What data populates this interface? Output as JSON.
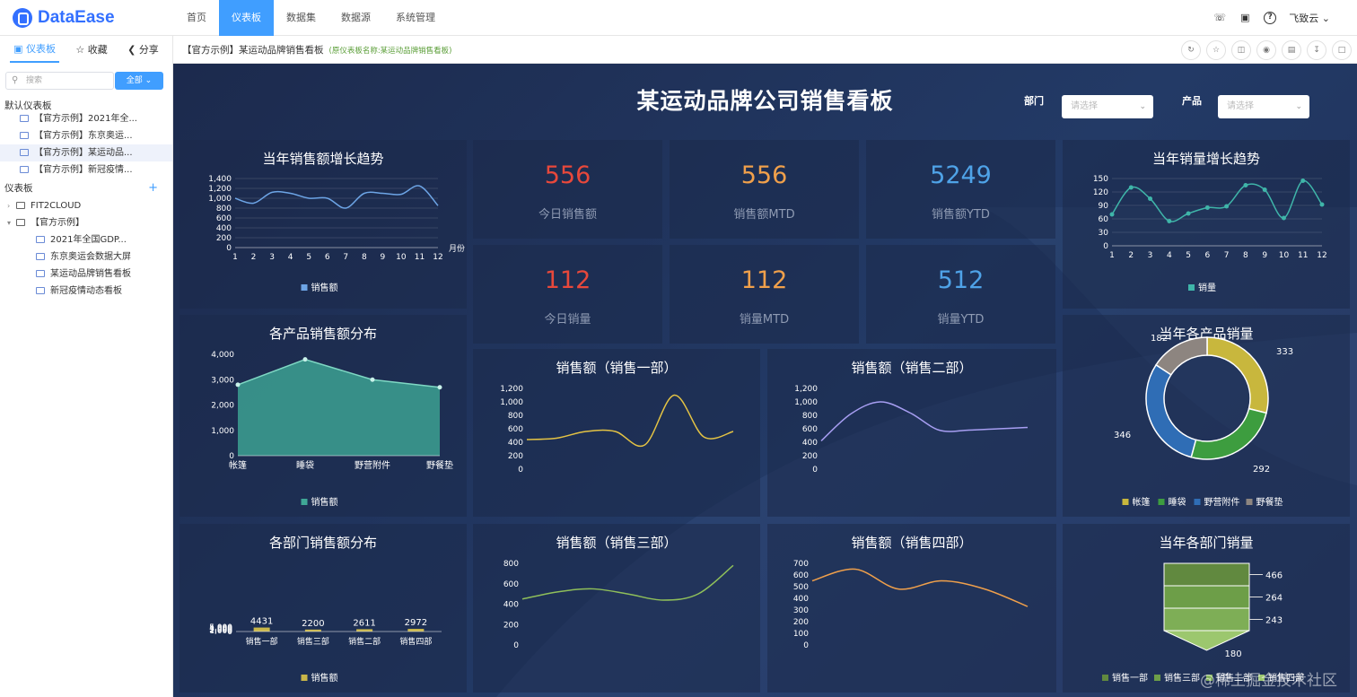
{
  "app": {
    "logo": "DataEase",
    "user": "飞致云"
  },
  "nav": [
    "首页",
    "仪表板",
    "数据集",
    "数据源",
    "系统管理"
  ],
  "sidebar": {
    "tabs": [
      "仪表板",
      "收藏",
      "分享"
    ],
    "search_placeholder": "搜索",
    "filter_label": "全部",
    "default_section": "默认仪表板",
    "default_items": [
      "【官方示例】2021年全...",
      "【官方示例】东京奥运...",
      "【官方示例】某运动品...",
      "【官方示例】新冠疫情..."
    ],
    "board_section": "仪表板",
    "tree": [
      {
        "label": "FIT2CLOUD",
        "level": 0,
        "type": "folder"
      },
      {
        "label": "【官方示例】",
        "level": 0,
        "type": "folder"
      },
      {
        "label": "2021年全国GDP...",
        "level": 1,
        "type": "dashboard"
      },
      {
        "label": "东京奥运会数据大屏",
        "level": 1,
        "type": "dashboard"
      },
      {
        "label": "某运动品牌销售看板",
        "level": 1,
        "type": "dashboard"
      },
      {
        "label": "新冠疫情动态看板",
        "level": 1,
        "type": "dashboard"
      }
    ]
  },
  "breadcrumb": {
    "title": "【官方示例】某运动品牌销售看板",
    "subtitle": "(原仪表板名称:某运动品牌销售看板)"
  },
  "board": {
    "title": "某运动品牌公司销售看板",
    "filters": [
      {
        "label": "部门",
        "placeholder": "请选择"
      },
      {
        "label": "产品",
        "placeholder": "请选择"
      }
    ],
    "kpis": [
      {
        "value": "556",
        "label": "今日销售额",
        "color": "#e8483b"
      },
      {
        "value": "556",
        "label": "销售额MTD",
        "color": "#f0a04b"
      },
      {
        "value": "5249",
        "label": "销售额YTD",
        "color": "#4fa3e8"
      },
      {
        "value": "112",
        "label": "今日销量",
        "color": "#e8483b"
      },
      {
        "value": "112",
        "label": "销量MTD",
        "color": "#f0a04b"
      },
      {
        "value": "512",
        "label": "销量YTD",
        "color": "#4fa3e8"
      }
    ]
  },
  "chart_data": [
    {
      "id": "c1",
      "type": "line",
      "title": "当年销售额增长趋势",
      "x": [
        1,
        2,
        3,
        4,
        5,
        6,
        7,
        8,
        9,
        10,
        11,
        12
      ],
      "series": [
        {
          "name": "销售额",
          "values": [
            1000,
            900,
            1120,
            1100,
            1000,
            1000,
            800,
            1100,
            1100,
            1080,
            1250,
            850
          ]
        }
      ],
      "ylim": [
        0,
        1400
      ],
      "yticks": [
        "0",
        "200",
        "400",
        "600",
        "800",
        "1,000",
        "1,200",
        "1,400"
      ],
      "xlabel": "月份",
      "color": "#6da5e6"
    },
    {
      "id": "c2",
      "type": "line",
      "title": "当年销量增长趋势",
      "x": [
        1,
        2,
        3,
        4,
        5,
        6,
        7,
        8,
        9,
        10,
        11,
        12
      ],
      "series": [
        {
          "name": "销量",
          "values": [
            70,
            130,
            105,
            55,
            72,
            85,
            88,
            135,
            125,
            62,
            145,
            92
          ]
        }
      ],
      "ylim": [
        0,
        150
      ],
      "yticks": [
        "0",
        "30",
        "60",
        "90",
        "120",
        "150"
      ],
      "color": "#3fb5a9"
    },
    {
      "id": "c3",
      "type": "area",
      "title": "各产品销售额分布",
      "categories": [
        "帐篷",
        "睡袋",
        "野营附件",
        "野餐垫"
      ],
      "series": [
        {
          "name": "销售额",
          "values": [
            2800,
            3800,
            3000,
            2700
          ]
        }
      ],
      "ylim": [
        0,
        4000
      ],
      "yticks": [
        "0",
        "1,000",
        "2,000",
        "3,000",
        "4,000"
      ],
      "color": "#3fa796"
    },
    {
      "id": "c4",
      "type": "line",
      "title": "销售额（销售一部）",
      "values": [
        440,
        460,
        560,
        560,
        360,
        1100,
        480,
        560
      ],
      "ylim": [
        0,
        1200
      ],
      "yticks": [
        "0",
        "200",
        "400",
        "600",
        "800",
        "1,000",
        "1,200"
      ],
      "color": "#e4c344"
    },
    {
      "id": "c5",
      "type": "line",
      "title": "销售额（销售二部）",
      "values": [
        420,
        820,
        1000,
        840,
        580,
        580,
        600,
        620
      ],
      "ylim": [
        0,
        1200
      ],
      "yticks": [
        "0",
        "200",
        "400",
        "600",
        "800",
        "1,000",
        "1,200"
      ],
      "color": "#a79ef2"
    },
    {
      "id": "c6",
      "type": "line",
      "title": "销售额（销售三部）",
      "values": [
        450,
        520,
        550,
        500,
        440,
        500,
        780
      ],
      "ylim": [
        0,
        800
      ],
      "yticks": [
        "0",
        "200",
        "400",
        "600",
        "800"
      ],
      "color": "#8fbf5a"
    },
    {
      "id": "c7",
      "type": "line",
      "title": "销售额（销售四部）",
      "values": [
        550,
        650,
        480,
        550,
        480,
        330
      ],
      "ylim": [
        0,
        700
      ],
      "yticks": [
        "0",
        "100",
        "200",
        "300",
        "400",
        "500",
        "600",
        "700"
      ],
      "color": "#f0a04b"
    },
    {
      "id": "c8",
      "type": "bar",
      "title": "各部门销售额分布",
      "categories": [
        "销售一部",
        "销售三部",
        "销售二部",
        "销售四部"
      ],
      "series": [
        {
          "name": "销售额",
          "values": [
            4431,
            2200,
            2611,
            2972
          ]
        }
      ],
      "ylim": [
        0,
        5000
      ],
      "yticks": [
        "0",
        "1,000",
        "2,000",
        "3,000",
        "4,000",
        "5,000"
      ],
      "color": "#c9b649"
    },
    {
      "id": "c9",
      "type": "pie",
      "title": "当年各产品销量",
      "categories": [
        "帐篷",
        "睡袋",
        "野营附件",
        "野餐垫"
      ],
      "values": [
        333,
        292,
        346,
        182
      ],
      "colors": [
        "#c8b73d",
        "#3d9d3f",
        "#2f6db5",
        "#8d8580"
      ]
    },
    {
      "id": "c10",
      "type": "funnel",
      "title": "当年各部门销量",
      "categories": [
        "销售一部",
        "销售三部",
        "销售二部",
        "销售四部"
      ],
      "values": [
        466,
        264,
        243,
        180
      ],
      "colors": [
        "#61893f",
        "#6d9e48",
        "#7eae56",
        "#9cc76e"
      ]
    }
  ],
  "watermark": "@稀土掘金技术社区"
}
